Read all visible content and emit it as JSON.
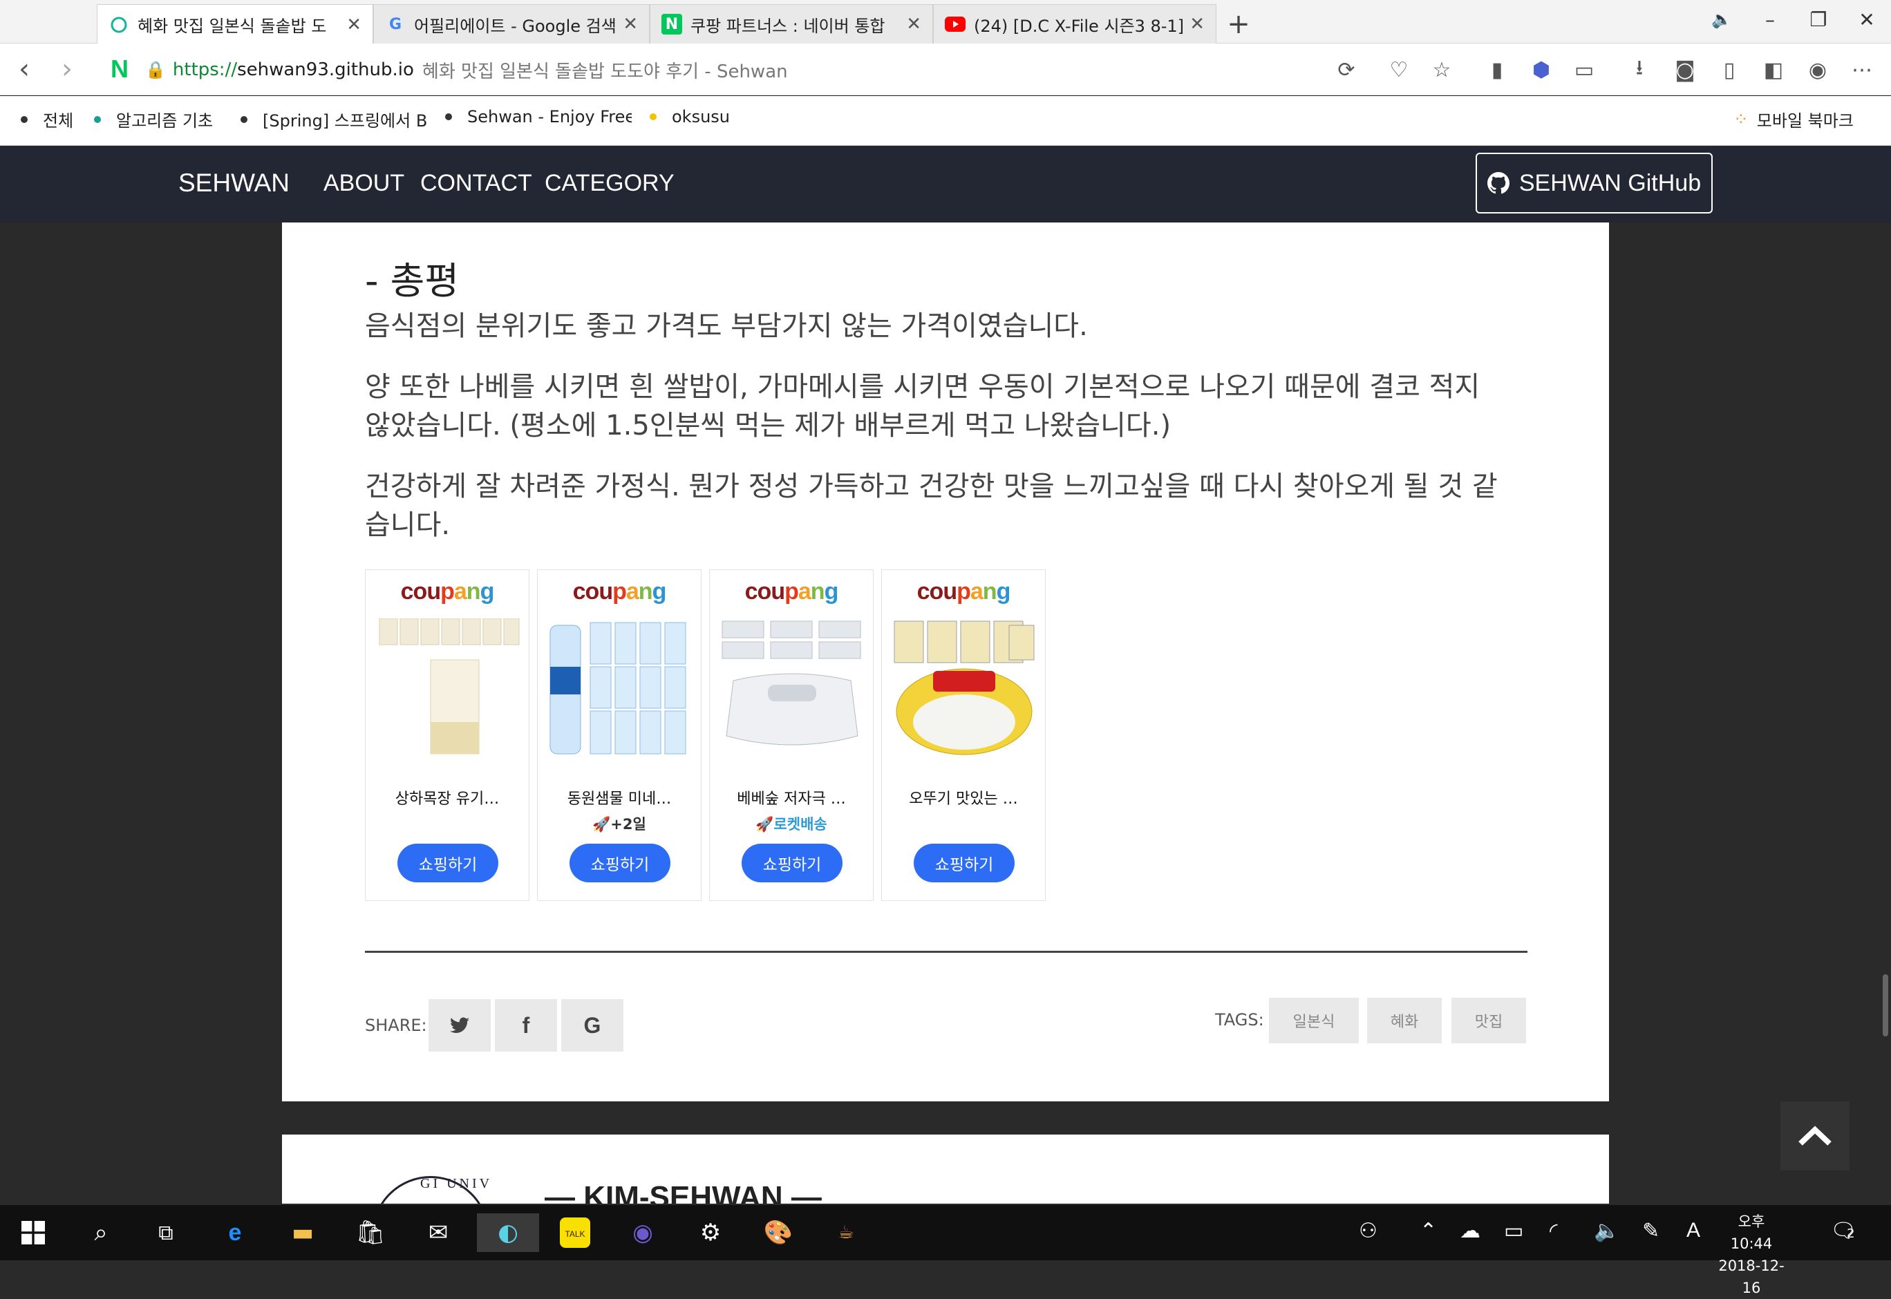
{
  "browser": {
    "tabs": [
      {
        "title": "혜화 맛집 일본식 돌솥밥 도",
        "favicon": "circle-icon",
        "active": true
      },
      {
        "title": "어필리에이트 - Google 검색",
        "favicon": "google-icon",
        "active": false
      },
      {
        "title": "쿠팡 파트너스 : 네이버 통합",
        "favicon": "naver-icon",
        "active": false
      },
      {
        "title": "(24) [D.C X-File 시즌3 8-1]",
        "favicon": "youtube-icon",
        "active": false
      }
    ],
    "new_tab": "+",
    "address": {
      "protocol": "https://",
      "host": "sehwan93.github.io",
      "page_title": "혜화 맛집 일본식 돌솥밥 도도야 후기 - Sehwan"
    },
    "bookmarks": [
      {
        "label": "전체",
        "color": "#333333"
      },
      {
        "label": "알고리즘 기초",
        "color": "#1a9e8f"
      },
      {
        "label": "[Spring] 스프링에서 B",
        "color": "#333333"
      },
      {
        "label": "Sehwan - Enjoy Freed",
        "color": "#333333"
      },
      {
        "label": "oksusu",
        "color": "#f2c200"
      }
    ],
    "mobile_bookmarks": "모바일 북마크"
  },
  "site": {
    "brand": "SEHWAN",
    "nav": [
      "ABOUT",
      "CONTACT",
      "CATEGORY"
    ],
    "github_button": "SEHWAN GitHub"
  },
  "post": {
    "heading": "- 총평",
    "paragraphs": [
      "음식점의 분위기도 좋고 가격도 부담가지 않는 가격이였습니다.",
      "양 또한 나베를 시키면 흰 쌀밥이, 가마메시를 시키면 우동이 기본적으로 나오기 때문에 결코 적지 않았습니다. (평소에 1.5인분씩 먹는 제가 배부르게 먹고 나왔습니다.)",
      "건강하게 잘 차려준 가정식. 뭔가 정성 가득하고 건강한 맛을 느끼고싶을 때 다시 찾아오게 될 것 같습니다."
    ],
    "products": [
      {
        "logo": "coupang",
        "name": "상하목장 유기…",
        "badge": "",
        "button": "쇼핑하기"
      },
      {
        "logo": "coupang",
        "name": "동원샘물 미네…",
        "badge": "🚀+2일",
        "button": "쇼핑하기"
      },
      {
        "logo": "coupang",
        "name": "베베숲 저자극 …",
        "badge": "🚀로켓배송",
        "button": "쇼핑하기"
      },
      {
        "logo": "coupang",
        "name": "오뚜기 맛있는 …",
        "badge": "",
        "button": "쇼핑하기"
      }
    ],
    "share_label": "SHARE:",
    "tags_label": "TAGS:",
    "tags": [
      "일본식",
      "혜화",
      "맛집"
    ]
  },
  "author": {
    "name": "— KIM-SEHWAN —",
    "seal_text": "GI UNIV"
  },
  "taskbar": {
    "time": "오후 10:44",
    "date": "2018-12-16",
    "ime": "A",
    "notifications": "2"
  },
  "colors": {
    "nav_bg": "#222733",
    "shop_button": "#2d6df6",
    "coupang_red": "#c8102e"
  }
}
